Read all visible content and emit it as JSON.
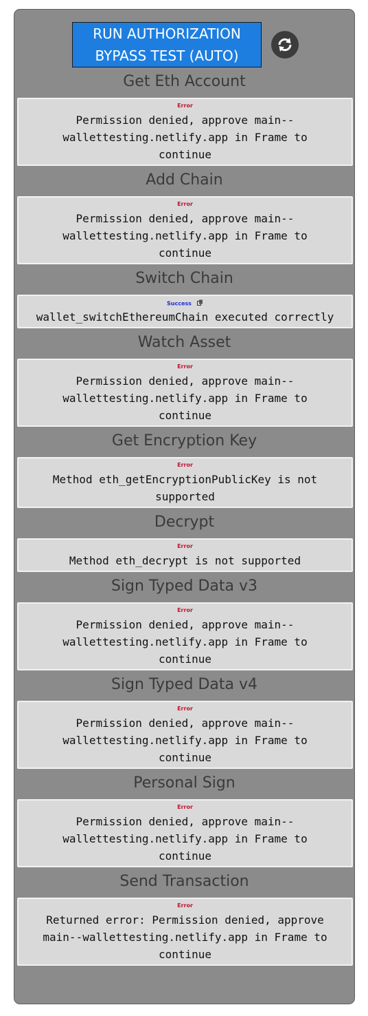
{
  "run_button": {
    "label_line1": "RUN AUTHORIZATION",
    "label_line2": "BYPASS TEST (AUTO)"
  },
  "refresh_icon": "refresh-icon",
  "sections": [
    {
      "title": "Get Eth Account",
      "status": "Error",
      "message_lines": [
        "Permission denied, approve main--",
        "wallettesting.netlify.app in Frame to",
        "continue"
      ]
    },
    {
      "title": "Add Chain",
      "status": "Error",
      "message_lines": [
        "Permission denied, approve main--",
        "wallettesting.netlify.app in Frame to",
        "continue"
      ]
    },
    {
      "title": "Switch Chain",
      "status": "Success",
      "message_lines": [
        "wallet_switchEthereumChain executed correctly"
      ]
    },
    {
      "title": "Watch Asset",
      "status": "Error",
      "message_lines": [
        "Permission denied, approve main--",
        "wallettesting.netlify.app in Frame to",
        "continue"
      ]
    },
    {
      "title": "Get Encryption Key",
      "status": "Error",
      "message_lines": [
        "Method eth_getEncryptionPublicKey is not",
        "supported"
      ]
    },
    {
      "title": "Decrypt",
      "status": "Error",
      "message_lines": [
        "Method eth_decrypt is not supported"
      ]
    },
    {
      "title": "Sign Typed Data v3",
      "status": "Error",
      "message_lines": [
        "Permission denied, approve main--",
        "wallettesting.netlify.app in Frame to",
        "continue"
      ]
    },
    {
      "title": "Sign Typed Data v4",
      "status": "Error",
      "message_lines": [
        "Permission denied, approve main--",
        "wallettesting.netlify.app in Frame to",
        "continue"
      ]
    },
    {
      "title": "Personal Sign",
      "status": "Error",
      "message_lines": [
        "Permission denied, approve main--",
        "wallettesting.netlify.app in Frame to",
        "continue"
      ]
    },
    {
      "title": "Send Transaction",
      "status": "Error",
      "message_lines": [
        "Returned error: Permission denied, approve",
        "main--wallettesting.netlify.app in Frame to",
        "continue"
      ]
    }
  ],
  "colors": {
    "panel": "#8b8b8b",
    "button": "#1d7ee0",
    "error": "#c0152f",
    "success": "#1f2bd6"
  }
}
